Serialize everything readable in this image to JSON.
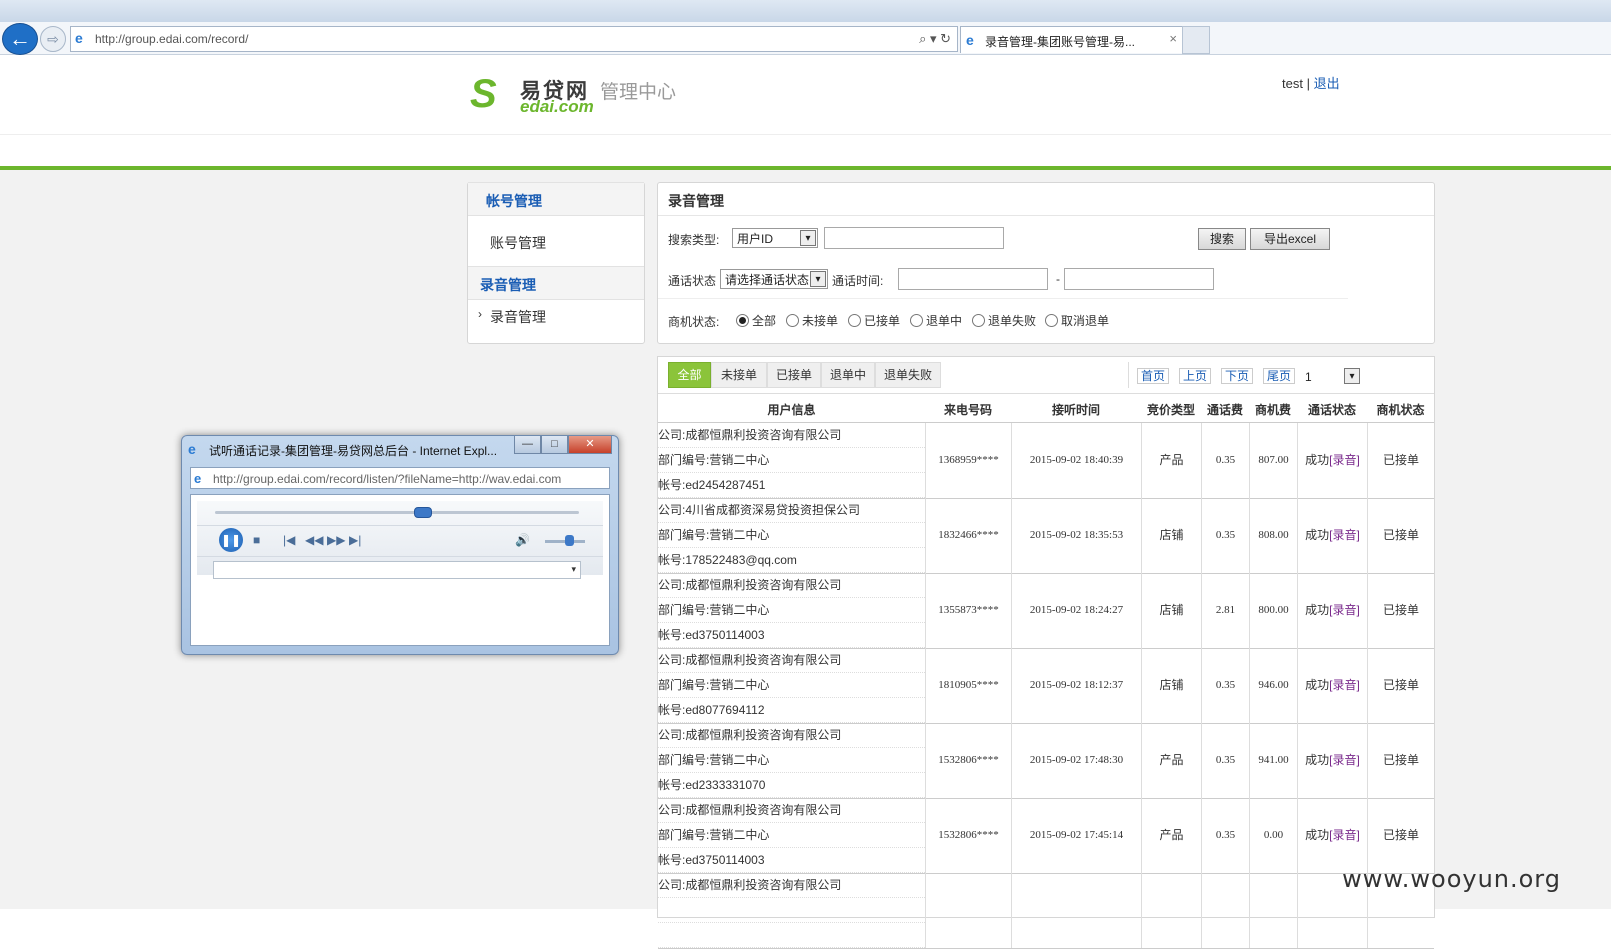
{
  "browser": {
    "url": "http://group.edai.com/record/",
    "tab_title": "录音管理-集团账号管理-易...",
    "tab_close": "×",
    "back_icon": "←",
    "forward_icon": "⇨",
    "tools": "⌕ ▾ ↻"
  },
  "header": {
    "logo_mark": "S",
    "logo_cn": "易贷网",
    "logo_en": "edai.com",
    "logo_sub": "管理中心",
    "user": "test",
    "sep": "|",
    "logout": "退出"
  },
  "sidebar": {
    "sections": [
      {
        "title": "帐号管理",
        "items": [
          "账号管理"
        ]
      },
      {
        "title": "录音管理",
        "items": [
          "录音管理"
        ]
      }
    ],
    "active_marker": "›"
  },
  "search": {
    "title": "录音管理",
    "type_label": "搜索类型:",
    "type_value": "用户ID",
    "search_btn": "搜索",
    "export_btn": "导出excel",
    "status_label": "通话状态",
    "status_value": "请选择通话状态",
    "time_label": "通话时间:",
    "time_sep": "-",
    "biz_label": "商机状态:",
    "biz_options": [
      "全部",
      "未接单",
      "已接单",
      "退单中",
      "退单失败",
      "取消退单"
    ],
    "biz_selected": 0,
    "dropdown_icon": "▾"
  },
  "results": {
    "tabs": [
      "全部",
      "未接单",
      "已接单",
      "退单中",
      "退单失败"
    ],
    "active_tab": 0,
    "pager": {
      "first": "首页",
      "prev": "上页",
      "next": "下页",
      "last": "尾页",
      "page": "1"
    },
    "columns": [
      "用户信息",
      "来电号码",
      "接听时间",
      "竞价类型",
      "通话费",
      "商机费",
      "通话状态",
      "商机状态"
    ],
    "rows": [
      {
        "company": "公司:成都恒鼎利投资咨询有限公司",
        "dept": "部门编号:营销二中心",
        "account": "帐号:ed2454287451",
        "phone": "1368959****",
        "time": "2015-09-02 18:40:39",
        "bid": "产品",
        "call_fee": "0.35",
        "biz_fee": "807.00",
        "call_status": "成功",
        "record": "[录音]",
        "biz_status": "已接单"
      },
      {
        "company": "公司:4川省成都资深易贷投资担保公司",
        "dept": "部门编号:营销二中心",
        "account": "帐号:178522483@qq.com",
        "phone": "1832466****",
        "time": "2015-09-02 18:35:53",
        "bid": "店铺",
        "call_fee": "0.35",
        "biz_fee": "808.00",
        "call_status": "成功",
        "record": "[录音]",
        "biz_status": "已接单"
      },
      {
        "company": "公司:成都恒鼎利投资咨询有限公司",
        "dept": "部门编号:营销二中心",
        "account": "帐号:ed3750114003",
        "phone": "1355873****",
        "time": "2015-09-02 18:24:27",
        "bid": "店铺",
        "call_fee": "2.81",
        "biz_fee": "800.00",
        "call_status": "成功",
        "record": "[录音]",
        "biz_status": "已接单"
      },
      {
        "company": "公司:成都恒鼎利投资咨询有限公司",
        "dept": "部门编号:营销二中心",
        "account": "帐号:ed8077694112",
        "phone": "1810905****",
        "time": "2015-09-02 18:12:37",
        "bid": "店铺",
        "call_fee": "0.35",
        "biz_fee": "946.00",
        "call_status": "成功",
        "record": "[录音]",
        "biz_status": "已接单"
      },
      {
        "company": "公司:成都恒鼎利投资咨询有限公司",
        "dept": "部门编号:营销二中心",
        "account": "帐号:ed2333331070",
        "phone": "1532806****",
        "time": "2015-09-02 17:48:30",
        "bid": "产品",
        "call_fee": "0.35",
        "biz_fee": "941.00",
        "call_status": "成功",
        "record": "[录音]",
        "biz_status": "已接单"
      },
      {
        "company": "公司:成都恒鼎利投资咨询有限公司",
        "dept": "部门编号:营销二中心",
        "account": "帐号:ed3750114003",
        "phone": "1532806****",
        "time": "2015-09-02 17:45:14",
        "bid": "产品",
        "call_fee": "0.35",
        "biz_fee": "0.00",
        "call_status": "成功",
        "record": "[录音]",
        "biz_status": "已接单"
      },
      {
        "company": "公司:成都恒鼎利投资咨询有限公司",
        "dept": "",
        "account": "",
        "phone": "",
        "time": "",
        "bid": "",
        "call_fee": "",
        "biz_fee": "",
        "call_status": "",
        "record": "",
        "biz_status": ""
      }
    ]
  },
  "popup": {
    "title": "试听通话记录-集团管理-易贷网总后台 - Internet Expl...",
    "url": "http://group.edai.com/record/listen/?fileName=http://wav.edai.com",
    "seek_progress": 0.57,
    "volume": 0.6,
    "pause_icon": "❚❚",
    "stop_icon": "■",
    "prev_icon": "|◀",
    "rewind_icon": "◀◀",
    "ffwd_icon": "▶▶",
    "next_icon": "▶|",
    "speaker_icon": "🔊",
    "min_icon": "—",
    "max_icon": "□",
    "close_icon": "✕"
  },
  "watermark": "www.wooyun.org"
}
